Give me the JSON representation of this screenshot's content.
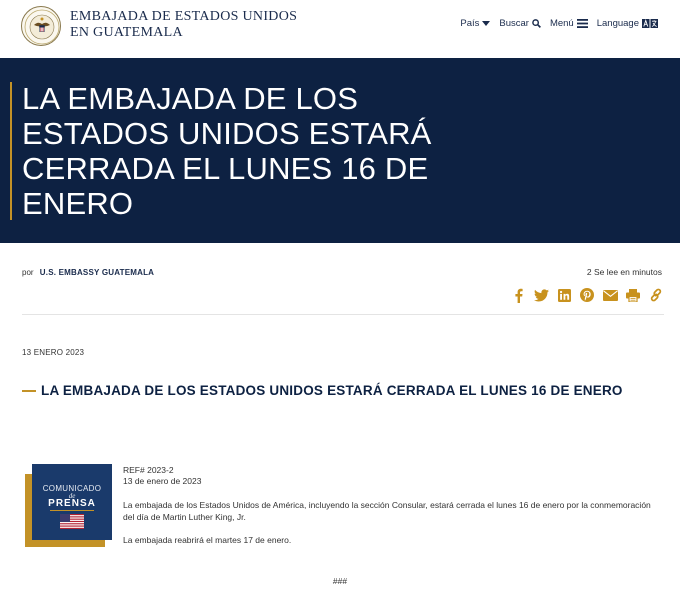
{
  "header": {
    "site_name_line1": "EMBAJADA DE ESTADOS UNIDOS",
    "site_name_line2": "EN GUATEMALA",
    "nav": {
      "country": "País",
      "search": "Buscar",
      "menu": "Menú",
      "language": "Language"
    }
  },
  "hero": {
    "title": "LA EMBAJADA DE LOS ESTADOS UNIDOS ESTARÁ CERRADA EL LUNES 16 DE ENERO"
  },
  "byline": {
    "prefix": "por",
    "author": "U.S. EMBASSY GUATEMALA",
    "read_time": "2 Se lee en minutos"
  },
  "share_icons": [
    "facebook-icon",
    "twitter-icon",
    "linkedin-icon",
    "pinterest-icon",
    "email-icon",
    "print-icon",
    "link-icon"
  ],
  "article": {
    "date": "13 ENERO 2023",
    "title": "LA EMBAJADA DE LOS ESTADOS UNIDOS ESTARÁ CERRADA EL LUNES 16 DE ENERO",
    "press_graphic": {
      "line1": "COMUNICADO",
      "line2": "de",
      "line3": "PRENSA"
    },
    "ref": "REF# 2023-2",
    "ref_date": "13 de enero de 2023",
    "paragraph1": "La embajada de los Estados Unidos de América, incluyendo la sección Consular, estará cerrada el lunes 16 de enero por la conmemoración del día de Martin Luther King, Jr.",
    "paragraph2": "La embajada reabrirá el martes 17 de enero.",
    "end_mark": "###"
  },
  "colors": {
    "navy": "#0d2142",
    "gold": "#c39227",
    "share_gold": "#c8921e"
  }
}
